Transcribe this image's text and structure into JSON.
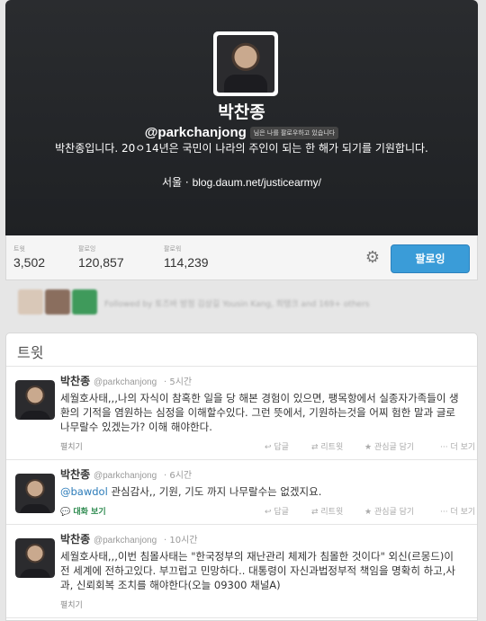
{
  "profile": {
    "name": "박찬종",
    "handle": "@parkchanjong",
    "follows_you": "님은 나를 팔로우하고 있습니다",
    "bio": "박찬종입니다. 20ㅇ14년은 국민이 나라의 주인이 되는 한 해가 되기를 기원합니다.",
    "location": "서울",
    "separator": "·",
    "url": "blog.daum.net/justicearmy/"
  },
  "stats": {
    "tweets_label": "트윗",
    "tweets_value": "3,502",
    "following_label": "팔로잉",
    "following_value": "120,857",
    "followers_label": "팔로워",
    "followers_value": "114,239",
    "follow_button": "팔로잉",
    "settings_icon": "gear-icon"
  },
  "followed_by": {
    "text": "Followed by 토즈바 방정 김상길 Yousin Kang, 희탱크 and 169+ others"
  },
  "tweets_header": "트윗",
  "tweets": [
    {
      "name": "박찬종",
      "handle": "@parkchanjong",
      "time": "· 5시간",
      "mention": "",
      "text": "세월호사태,,,나의 자식이 참혹한 일을  당 해본  경험이 있으면,  팽목항에서 실종자가족들이 생환의 기적을 염원하는 심정을 이해할수있다. 그런  뜻에서, 기원하는것을 어찌  험한 말과 글로 나무랄수 있겠는가? 이해 해야한다.",
      "footer": "펼치기",
      "footer_type": "expand"
    },
    {
      "name": "박찬종",
      "handle": "@parkchanjong",
      "time": "· 6시간",
      "mention": "@bawdol",
      "text": " 관심감사,, 기원, 기도 까지 나무랄수는 없겠지요.",
      "footer": "대화 보기",
      "footer_type": "conversation"
    },
    {
      "name": "박찬종",
      "handle": "@parkchanjong",
      "time": "· 10시간",
      "mention": "",
      "text": "세월호사태,,,이번 침몰사태는  \"한국정부의  재난관리 체제가 침몰한 것이다\" 외신(르몽드)이  전 세계에  전하고있다. 부끄럽고 민망하다.. 대통령이 자신과법정부적 책임을 명확히  하고,사과, 신뢰회복 조치를 해야한다(오늘 09300 채널A)",
      "footer": "펼치기",
      "footer_type": "expand"
    }
  ],
  "actions": {
    "reply": "↩ 답글",
    "retweet": "⇄ 리트윗",
    "favorite": "★ 관심글 담기",
    "more": "··· 더 보기"
  },
  "colors": {
    "follow_button": "#3a9cd8",
    "header_bg": "#2a2c2f",
    "link": "#2b7bb9",
    "conversation": "#2d8a4f"
  }
}
